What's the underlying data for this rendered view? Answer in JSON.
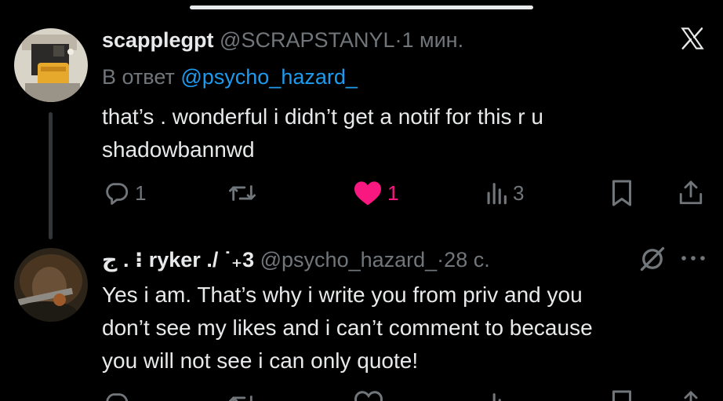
{
  "tweet1": {
    "display_name": "scapplegpt",
    "handle": "@SCRAPSTANYL",
    "separator": "·",
    "time": "1 мин.",
    "replying_prefix": "В ответ",
    "replying_to": "@psycho_hazard_",
    "text_line1": "that’s . wonderful i didn’t get a notif for this r u",
    "text_line2": "shadowbannwd",
    "actions": {
      "replies": "1",
      "reposts": "",
      "likes": "1",
      "views": "3"
    }
  },
  "tweet2": {
    "display_name_prefix": "ج . ⁝",
    "display_name": "ryker",
    "display_name_suffix": "./ ˙₊3",
    "handle": "@psycho_hazard_",
    "separator": "·",
    "time": "28 с.",
    "text_line1": "Yes i am. That’s why i write you from priv and you",
    "text_line2": "don’t see my likes and i can’t comment to because",
    "text_line3": "you will not see i can only quote!"
  },
  "colors": {
    "background": "#000000",
    "text": "#e7e9ea",
    "muted": "#71767b",
    "link": "#1d9bf0",
    "like": "#f91880"
  },
  "icons": [
    "x-logo-icon",
    "reply-icon",
    "repost-icon",
    "heart-icon",
    "views-icon",
    "bookmark-icon",
    "share-icon",
    "grok-icon",
    "more-icon"
  ]
}
